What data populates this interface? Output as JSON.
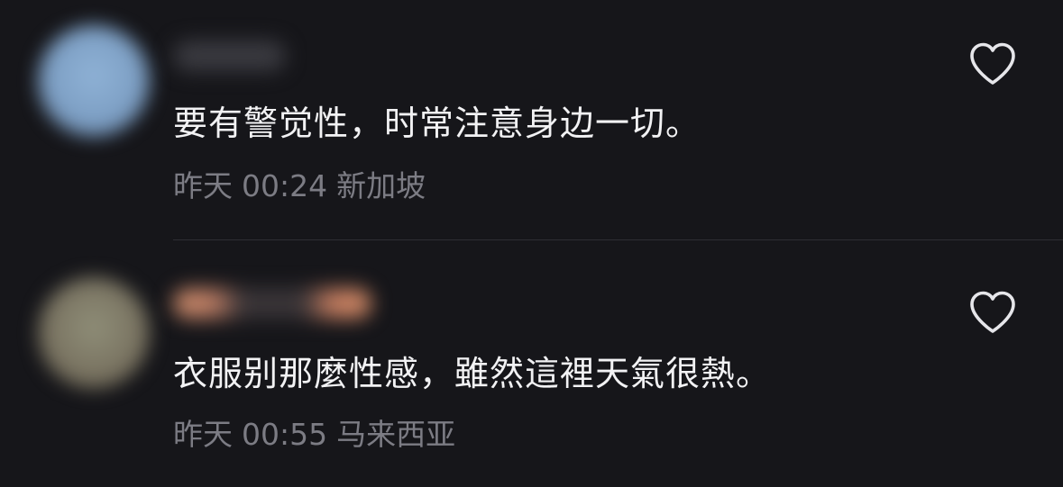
{
  "comments": [
    {
      "text": "要有警觉性，时常注意身边一切。",
      "date": "昨天",
      "time": "00:24",
      "location": "新加坡",
      "like_icon": "heart-outline-icon"
    },
    {
      "text": "衣服别那麼性感，雖然這裡天氣很熱。",
      "date": "昨天",
      "time": "00:55",
      "location": "马来西亚",
      "like_icon": "heart-outline-icon"
    }
  ]
}
